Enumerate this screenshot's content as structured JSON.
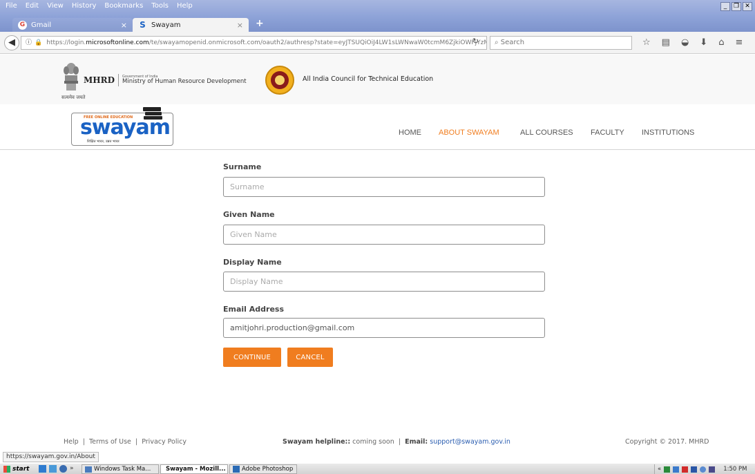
{
  "browser": {
    "menu": [
      "File",
      "Edit",
      "View",
      "History",
      "Bookmarks",
      "Tools",
      "Help"
    ],
    "window_controls": [
      "_",
      "❐",
      "✕"
    ],
    "tabs": [
      {
        "label": "Gmail",
        "close": "×"
      },
      {
        "label": "Swayam",
        "close": "×"
      }
    ],
    "new_tab": "+",
    "back": "◀",
    "url": {
      "prefix": "https://login.",
      "host": "microsoftonline.com",
      "rest": "/te/swayamopenid.onmicrosoft.com/oauth2/authresp?state=eyJTSUQiOiJ4LW1sLWNwaW0tcmM6ZjkiOWFjYzM"
    },
    "reload": "↻",
    "search_placeholder": "Search",
    "icons": [
      "star-icon",
      "reading-list-icon",
      "pocket-icon",
      "download-icon",
      "home-icon",
      "menu-icon"
    ]
  },
  "gov_header": {
    "emblem_caption": "सत्यमेव जयते",
    "mhrd": "MHRD",
    "gov_of_india": "Government of India",
    "ministry": "Ministry of Human Resource Development",
    "aicte": "All India Council for Technical Education"
  },
  "site": {
    "logo_free": "FREE ONLINE EDUCATION",
    "logo_word": "swayam",
    "logo_tag": "शिक्षित भारत, उन्नत भारत",
    "nav": [
      {
        "label": "HOME",
        "color": "#555555"
      },
      {
        "label": "ABOUT SWAYAM",
        "color": "#f07d1f"
      },
      {
        "label": "ALL COURSES",
        "color": "#555555"
      },
      {
        "label": "FACULTY",
        "color": "#555555"
      },
      {
        "label": "INSTITUTIONS",
        "color": "#555555"
      }
    ]
  },
  "form": {
    "surname": {
      "label": "Surname",
      "value": "",
      "placeholder": "Surname"
    },
    "given_name": {
      "label": "Given Name",
      "value": "",
      "placeholder": "Given Name"
    },
    "display_name": {
      "label": "Display Name",
      "value": "",
      "placeholder": "Display Name"
    },
    "email": {
      "label": "Email Address",
      "value": "amitjohri.production@gmail.com",
      "placeholder": ""
    },
    "continue": "CONTINUE",
    "cancel": "CANCEL"
  },
  "footer": {
    "links": [
      "Help",
      "Terms of Use",
      "Privacy Policy"
    ],
    "helpline_label": "Swayam helpline::",
    "helpline_value": "coming soon",
    "email_label": "Email:",
    "email_value": "support@swayam.gov.in",
    "copyright": "Copyright © 2017. MHRD"
  },
  "status_url": "https://swayam.gov.in/About",
  "taskbar": {
    "start": "start",
    "overflow": "»",
    "items": [
      {
        "label": "Windows Task Ma..."
      },
      {
        "label": "Swayam - Mozill..."
      },
      {
        "label": "Adobe Photoshop"
      }
    ],
    "tray_overflow": "«",
    "clock": "1:50 PM"
  },
  "colors": {
    "accent": "#f07d1f",
    "logo_blue": "#1a62c4",
    "link_blue": "#2a5db0"
  }
}
